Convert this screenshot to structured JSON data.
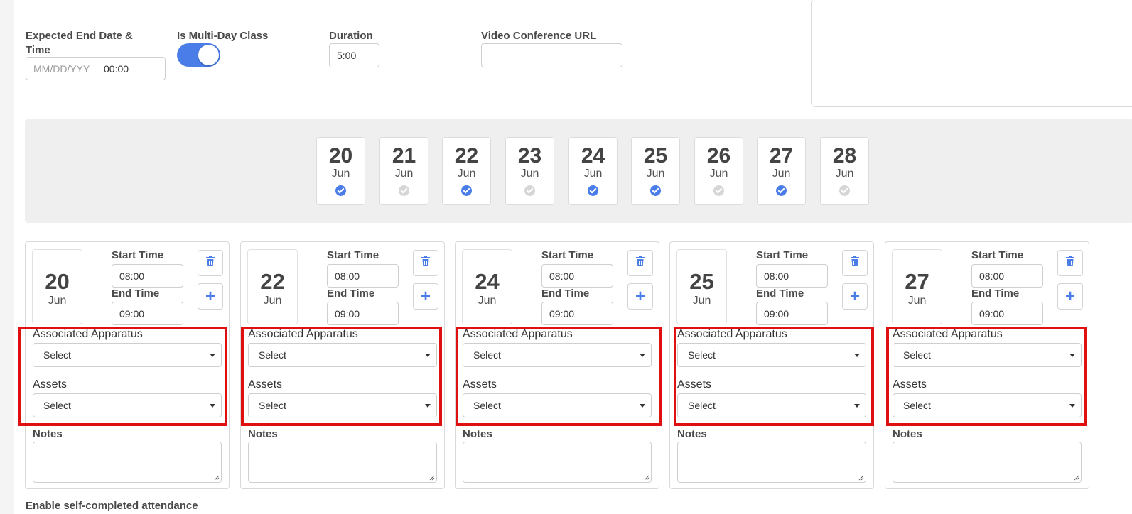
{
  "form": {
    "end_date_label": "Expected End Date & Time",
    "end_date_placeholder": "MM/DD/YYYY",
    "end_time_value": "00:00",
    "multi_day_label": "Is Multi-Day Class",
    "multi_day_on": true,
    "duration_label": "Duration",
    "duration_value": "5:00",
    "video_url_label": "Video Conference URL",
    "video_url_value": ""
  },
  "day_strip": [
    {
      "num": "20",
      "mon": "Jun",
      "selected": true
    },
    {
      "num": "21",
      "mon": "Jun",
      "selected": false
    },
    {
      "num": "22",
      "mon": "Jun",
      "selected": true
    },
    {
      "num": "23",
      "mon": "Jun",
      "selected": false
    },
    {
      "num": "24",
      "mon": "Jun",
      "selected": true
    },
    {
      "num": "25",
      "mon": "Jun",
      "selected": true
    },
    {
      "num": "26",
      "mon": "Jun",
      "selected": false
    },
    {
      "num": "27",
      "mon": "Jun",
      "selected": true
    },
    {
      "num": "28",
      "mon": "Jun",
      "selected": false
    }
  ],
  "session_labels": {
    "start_time": "Start Time",
    "end_time": "End Time",
    "apparatus": "Associated Apparatus",
    "assets": "Assets",
    "notes": "Notes",
    "select_placeholder": "Select"
  },
  "sessions": [
    {
      "num": "20",
      "mon": "Jun",
      "start": "08:00",
      "end": "09:00"
    },
    {
      "num": "22",
      "mon": "Jun",
      "start": "08:00",
      "end": "09:00"
    },
    {
      "num": "24",
      "mon": "Jun",
      "start": "08:00",
      "end": "09:00"
    },
    {
      "num": "25",
      "mon": "Jun",
      "start": "08:00",
      "end": "09:00"
    },
    {
      "num": "27",
      "mon": "Jun",
      "start": "08:00",
      "end": "09:00"
    }
  ],
  "footer_text": "Enable self-completed attendance",
  "colors": {
    "accent": "#4a7de8",
    "highlight": "#e01010"
  },
  "icons": {
    "delete": "trash-icon",
    "add": "plus-icon",
    "checked": "check-circle-icon",
    "dropdown": "caret-down-icon"
  }
}
